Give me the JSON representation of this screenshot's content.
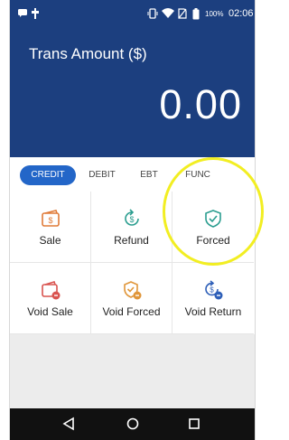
{
  "status_bar": {
    "battery_text": "100%",
    "time": "02:06",
    "icons": [
      "message-icon",
      "usb-icon",
      "vibrate-icon",
      "wifi-icon",
      "no-sim-icon",
      "battery-icon"
    ]
  },
  "header": {
    "amount_label": "Trans Amount ($)",
    "amount_value": "0.00"
  },
  "tabs": [
    {
      "label": "CREDIT",
      "active": true
    },
    {
      "label": "DEBIT",
      "active": false
    },
    {
      "label": "EBT",
      "active": false
    },
    {
      "label": "FUNC",
      "active": false
    }
  ],
  "actions": [
    {
      "label": "Sale",
      "icon": "sale-icon",
      "color": "#e07b39"
    },
    {
      "label": "Refund",
      "icon": "refund-icon",
      "color": "#2a9d8f"
    },
    {
      "label": "Forced",
      "icon": "forced-icon",
      "color": "#2a9d8f"
    },
    {
      "label": "Void Sale",
      "icon": "void-sale-icon",
      "color": "#d9534f"
    },
    {
      "label": "Void Forced",
      "icon": "void-forced-icon",
      "color": "#e0963a"
    },
    {
      "label": "Void Return",
      "icon": "void-return-icon",
      "color": "#2e5fb8"
    }
  ],
  "nav_bar": {
    "icons": [
      "back-icon",
      "home-icon",
      "recents-icon"
    ]
  },
  "colors": {
    "header_bg": "#1c3f7f",
    "active_tab": "#2366c8",
    "highlight": "#f2ee22"
  }
}
